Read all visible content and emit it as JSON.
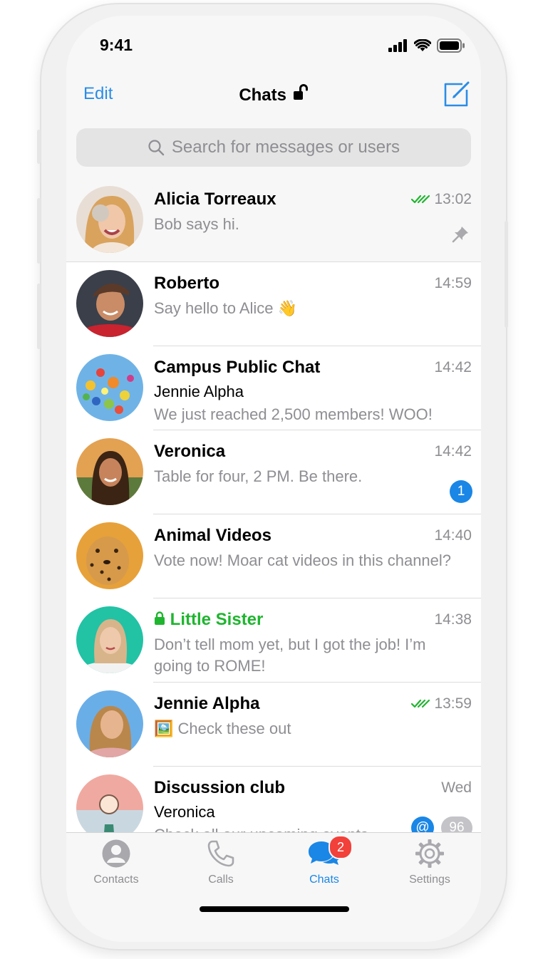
{
  "status_bar": {
    "time": "9:41"
  },
  "nav": {
    "edit_label": "Edit",
    "title": "Chats"
  },
  "search": {
    "placeholder": "Search for messages or users"
  },
  "chats": [
    {
      "name": "Alicia Torreaux",
      "time": "13:02",
      "message": "Bob says hi.",
      "read": true,
      "pinned": true
    },
    {
      "name": "Roberto",
      "time": "14:59",
      "message": "Say hello to Alice 👋"
    },
    {
      "name": "Campus Public Chat",
      "time": "14:42",
      "sender": "Jennie Alpha",
      "message": "We just reached 2,500 members! WOO!"
    },
    {
      "name": "Veronica",
      "time": "14:42",
      "message": "Table for four, 2 PM. Be there.",
      "unread": "1"
    },
    {
      "name": "Animal Videos",
      "time": "14:40",
      "message": "Vote now! Moar cat videos in this channel?"
    },
    {
      "name": "Little Sister",
      "time": "14:38",
      "message": "Don’t tell mom yet, but I got the job! I’m going to ROME!",
      "secret": true
    },
    {
      "name": "Jennie Alpha",
      "time": "13:59",
      "message": "🖼️ Check these out",
      "read": true
    },
    {
      "name": "Discussion club",
      "time": "Wed",
      "sender": "Veronica",
      "message": "Check all our upcoming events",
      "mention": "@",
      "unread": "96"
    }
  ],
  "tabs": [
    {
      "label": "Contacts"
    },
    {
      "label": "Calls"
    },
    {
      "label": "Chats",
      "badge": "2",
      "active": true
    },
    {
      "label": "Settings"
    }
  ],
  "colors": {
    "accent": "#1a86e6",
    "secret_green": "#1fb52f",
    "badge_red": "#f2403a"
  }
}
